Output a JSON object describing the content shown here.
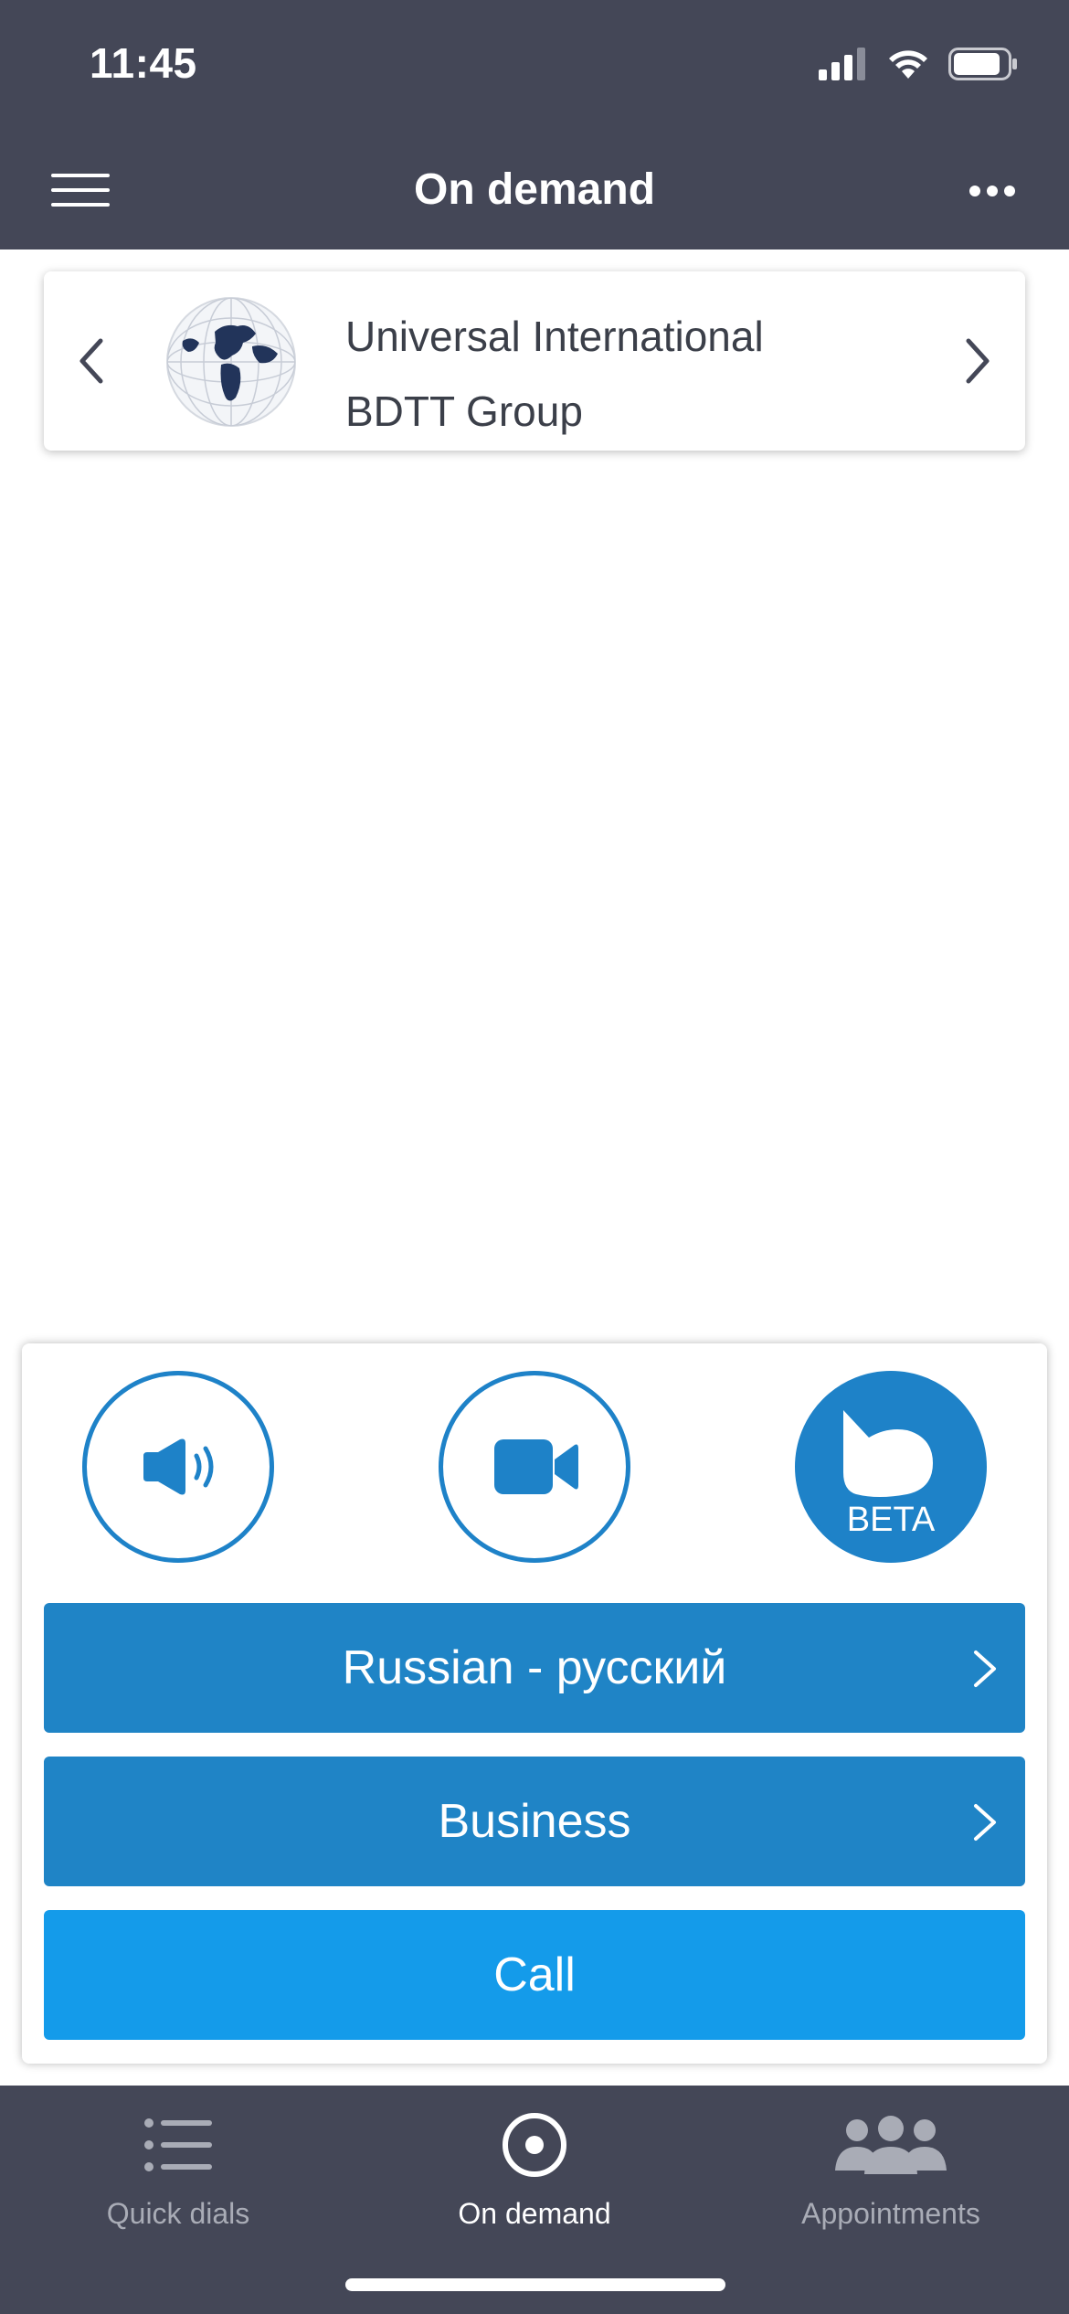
{
  "status": {
    "time": "11:45"
  },
  "header": {
    "title": "On demand"
  },
  "organization": {
    "name_line1": "Universal International",
    "name_line2": "BDTT Group"
  },
  "modes": {
    "beta_label": "BETA"
  },
  "selectors": {
    "language": "Russian - русский",
    "category": "Business"
  },
  "actions": {
    "call_label": "Call"
  },
  "tabs": [
    {
      "label": "Quick dials",
      "icon": "list-icon",
      "active": false
    },
    {
      "label": "On demand",
      "icon": "target-icon",
      "active": true
    },
    {
      "label": "Appointments",
      "icon": "people-icon",
      "active": false
    }
  ],
  "colors": {
    "header_bg": "#444757",
    "primary_blue": "#1f84c6",
    "call_blue": "#149bea"
  }
}
